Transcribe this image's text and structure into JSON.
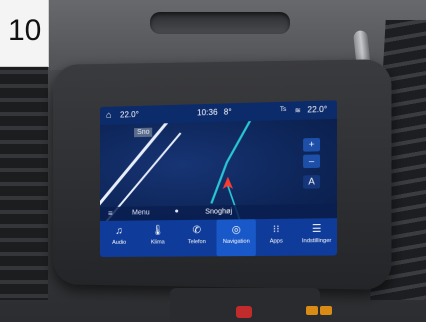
{
  "photo_label": "10",
  "status": {
    "home_icon": "home-icon",
    "outside_temp": "22.0°",
    "time": "10:36",
    "inside_temp": "8°",
    "right_temp": "22.0°",
    "right_prefix": "Ts"
  },
  "map": {
    "street_top": "Sno",
    "street_bottom": "Snoghøj",
    "zoom_in_label": "+",
    "zoom_out_label": "–",
    "north_label": "A"
  },
  "infobar": {
    "menu_label": "Menu"
  },
  "nav": [
    {
      "label": "Audio",
      "icon": "music-icon"
    },
    {
      "label": "Klima",
      "icon": "temp-icon"
    },
    {
      "label": "Telefon",
      "icon": "phone-icon"
    },
    {
      "label": "Navigation",
      "icon": "nav-icon"
    },
    {
      "label": "Apps",
      "icon": "apps-icon"
    },
    {
      "label": "Indstillinger",
      "icon": "settings-icon"
    }
  ],
  "colors": {
    "screen_bg": "#0b2150",
    "nav_bar": "#0f3b9a",
    "accent": "#1858c8",
    "route_cyan": "#28c6d6",
    "position_red": "#ff3b2f"
  }
}
